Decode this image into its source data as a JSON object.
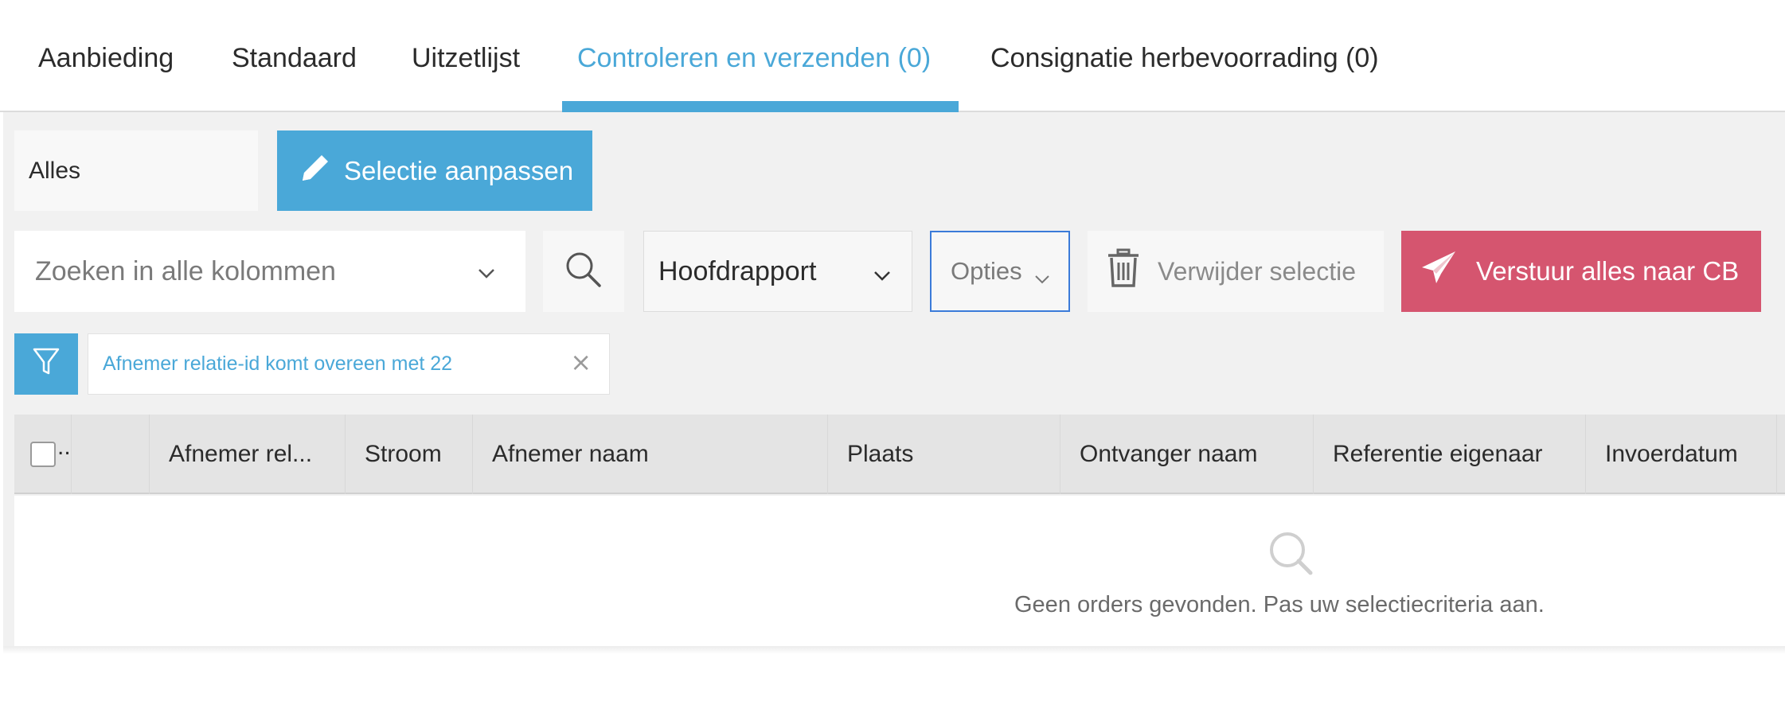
{
  "tabs": [
    {
      "label": "Aanbieding",
      "active": false
    },
    {
      "label": "Standaard",
      "active": false
    },
    {
      "label": "Uitzetlijst",
      "active": false
    },
    {
      "label": "Controleren en verzenden (0)",
      "active": true
    },
    {
      "label": "Consignatie herbevoorrading (0)",
      "active": false
    }
  ],
  "selection": {
    "current": "Alles",
    "edit_label": "Selectie aanpassen"
  },
  "search": {
    "placeholder": "Zoeken in alle kolommen"
  },
  "report": {
    "selected": "Hoofdrapport"
  },
  "options": {
    "label": "Opties"
  },
  "actions": {
    "delete_label": "Verwijder selectie",
    "send_label": "Verstuur alles naar CB"
  },
  "filter": {
    "chip_text": "Afnemer relatie-id komt overeen met 22",
    "close_glyph": "×"
  },
  "table": {
    "select_all_ellipsis": "..",
    "columns": [
      "Afnemer rel...",
      "Stroom",
      "Afnemer naam",
      "Plaats",
      "Ontvanger naam",
      "Referentie eigenaar",
      "Invoerdatum"
    ],
    "empty_message": "Geen orders gevonden. Pas uw selectiecriteria aan."
  },
  "colors": {
    "accent": "#4aa8d8",
    "send": "#d5556f",
    "focus_border": "#3b7bd9"
  }
}
